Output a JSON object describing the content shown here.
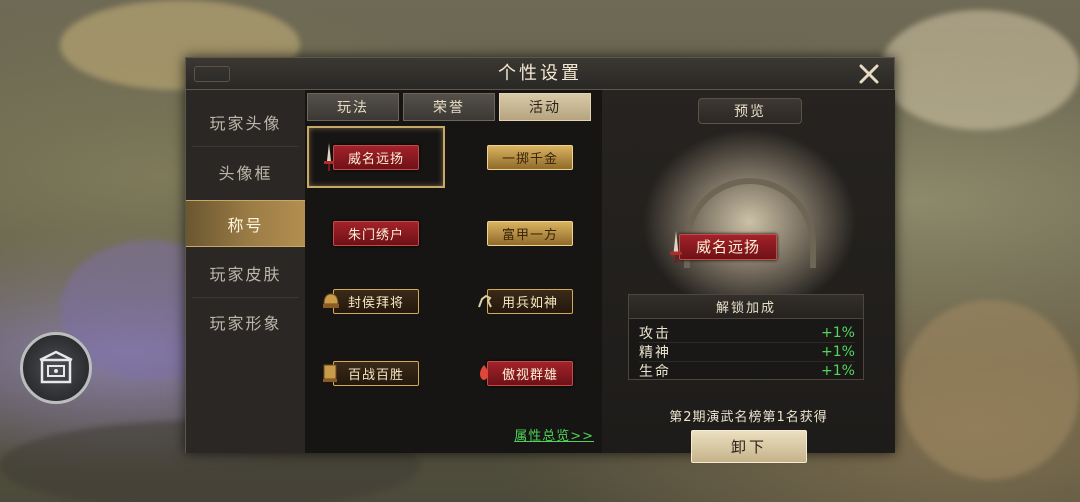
{
  "dialog": {
    "title": "个性设置"
  },
  "nav": {
    "items": [
      {
        "label": "玩家头像",
        "active": false
      },
      {
        "label": "头像框",
        "active": false
      },
      {
        "label": "称号",
        "active": true
      },
      {
        "label": "玩家皮肤",
        "active": false
      },
      {
        "label": "玩家形象",
        "active": false
      }
    ]
  },
  "tabs": [
    {
      "label": "玩法",
      "active": false
    },
    {
      "label": "荣誉",
      "active": false
    },
    {
      "label": "活动",
      "active": true
    }
  ],
  "titles": [
    {
      "label": "威名远扬",
      "style": "red",
      "selected": true
    },
    {
      "label": "一掷千金",
      "style": "gold",
      "selected": false
    },
    {
      "label": "朱门绣户",
      "style": "red",
      "selected": false
    },
    {
      "label": "富甲一方",
      "style": "gold",
      "selected": false
    },
    {
      "label": "封侯拜将",
      "style": "dark",
      "selected": false
    },
    {
      "label": "用兵如神",
      "style": "dark",
      "selected": false
    },
    {
      "label": "百战百胜",
      "style": "dark",
      "selected": false
    },
    {
      "label": "傲视群雄",
      "style": "red",
      "selected": false
    }
  ],
  "attributes_link": "属性总览>>",
  "preview": {
    "label": "预览",
    "title": "威名远扬",
    "unlock_header": "解锁加成",
    "stats": [
      {
        "name": "攻击",
        "value": "+1%"
      },
      {
        "name": "精神",
        "value": "+1%"
      },
      {
        "name": "生命",
        "value": "+1%"
      }
    ],
    "source": "第2期演武名榜第1名获得",
    "unequip_label": "卸下"
  },
  "colors": {
    "accent_gold": "#b38f50",
    "bonus_green": "#52d65d",
    "title_red": "#a3222a"
  }
}
